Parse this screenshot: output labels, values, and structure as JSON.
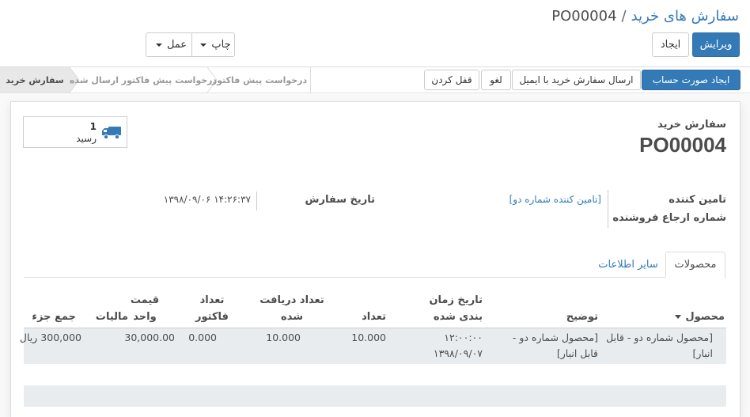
{
  "breadcrumb": {
    "parent": "سفارش های خرید",
    "separator": "/",
    "current": "PO00004"
  },
  "toolbar": {
    "edit_label": "ویرایش",
    "create_label": "ایجاد",
    "print_label": "چاپ",
    "action_label": "عمل"
  },
  "header_buttons": {
    "create_bill": "ایجاد صورت حساب",
    "send_po_email": "ارسال سفارش خرید با ایمیل",
    "cancel": "لغو",
    "lock": "قفل کردن"
  },
  "stages": {
    "purchase_order": "سفارش خرید",
    "rfq_sent": "درخواست پیش فاکتور ارسال شده",
    "rfq": "درخواست پیش فاکتور"
  },
  "smart_button": {
    "count": "1",
    "label": "رسید",
    "icon": "truck-icon"
  },
  "form": {
    "title_label": "سفارش خرید",
    "name": "PO00004",
    "vendor_label": "تامین کننده",
    "vendor_value": "[تامین کننده شماره دو]",
    "vendor_ref_label": "شماره ارجاع فروشنده",
    "order_date_label": "تاریخ سفارش",
    "order_date_value": "۱۴:۲۶:۳۷ ۱۳۹۸/۰۹/۰۶"
  },
  "tabs": {
    "products": "محصولات",
    "other_info": "سایر اطلاعات"
  },
  "table": {
    "headers": {
      "product": "محصول",
      "description": "توضیح",
      "scheduled_date": "تاریخ زمان بندی شده",
      "quantity": "تعداد",
      "received": "تعداد دریافت شده",
      "billed": "تعداد فاکتور شده",
      "unit_price": "قیمت واحد",
      "taxes": "مالیات",
      "subtotal": "جمع جزء"
    },
    "rows": [
      {
        "product": "[محصول شماره دو - قابل انبار]",
        "description": "[محصول شماره دو - قابل انبار]",
        "scheduled_date": "۱۲:۰۰:۰۰ ۱۳۹۸/۰۹/۰۷",
        "quantity": "10.000",
        "received": "10.000",
        "billed": "0.000",
        "unit_price": "30,000.00",
        "taxes": "",
        "subtotal": "300,000 ریال"
      }
    ]
  },
  "colors": {
    "primary": "#337ab7",
    "create_bill": "#337ab7",
    "row_bg": "#e9ecef"
  }
}
